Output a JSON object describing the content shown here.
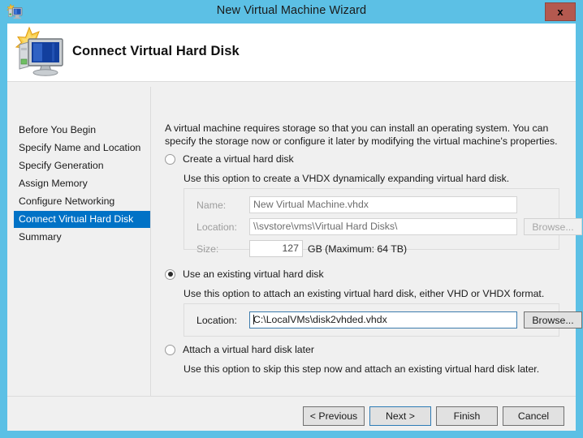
{
  "window": {
    "title": "New Virtual Machine Wizard",
    "icon": "vm-wizard-icon",
    "close_label": "x"
  },
  "header": {
    "title": "Connect Virtual Hard Disk",
    "icon": "virtual-machine-icon"
  },
  "sidebar": {
    "items": [
      {
        "label": "Before You Begin",
        "selected": false
      },
      {
        "label": "Specify Name and Location",
        "selected": false
      },
      {
        "label": "Specify Generation",
        "selected": false
      },
      {
        "label": "Assign Memory",
        "selected": false
      },
      {
        "label": "Configure Networking",
        "selected": false
      },
      {
        "label": "Connect Virtual Hard Disk",
        "selected": true
      },
      {
        "label": "Summary",
        "selected": false
      }
    ]
  },
  "main": {
    "intro": "A virtual machine requires storage so that you can install an operating system. You can specify the storage now or configure it later by modifying the virtual machine's properties.",
    "option_create": {
      "label": "Create a virtual hard disk",
      "selected": false,
      "description": "Use this option to create a VHDX dynamically expanding virtual hard disk.",
      "name_label": "Name:",
      "name_value": "New Virtual Machine.vhdx",
      "location_label": "Location:",
      "location_value": "\\\\svstore\\vms\\Virtual Hard Disks\\",
      "browse_label": "Browse...",
      "size_label": "Size:",
      "size_value": "127",
      "size_unit": "GB (Maximum: 64 TB)"
    },
    "option_existing": {
      "label": "Use an existing virtual hard disk",
      "selected": true,
      "description": "Use this option to attach an existing virtual hard disk, either VHD or VHDX format.",
      "location_label": "Location:",
      "location_value": "C:\\LocalVMs\\disk2vhded.vhdx",
      "browse_label": "Browse..."
    },
    "option_later": {
      "label": "Attach a virtual hard disk later",
      "selected": false,
      "description": "Use this option to skip this step now and attach an existing virtual hard disk later."
    }
  },
  "footer": {
    "previous_label": "< Previous",
    "next_label": "Next >",
    "finish_label": "Finish",
    "cancel_label": "Cancel"
  },
  "colors": {
    "titlebar": "#5cc0e5",
    "accent": "#0072c6",
    "close": "#b4594f",
    "body": "#f0f0f0"
  }
}
